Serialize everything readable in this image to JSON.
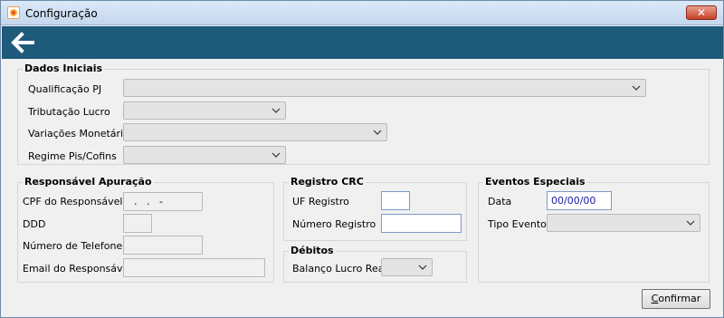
{
  "window": {
    "title": "Configuração",
    "close_label": "✕"
  },
  "toolbar": {
    "back_icon": "arrow-left-icon"
  },
  "dados_iniciais": {
    "title": "Dados Iniciais",
    "qualificacao_label": "Qualificação PJ",
    "qualificacao_value": "",
    "tributacao_label": "Tributação Lucro",
    "tributacao_value": "",
    "variacoes_label": "Variações Monetárias",
    "variacoes_value": "",
    "regime_label": "Regime Pis/Cofins",
    "regime_value": ""
  },
  "responsavel": {
    "title": "Responsável Apuração",
    "cpf_label": "CPF do Responsável",
    "cpf_value": "  .   .   -",
    "ddd_label": "DDD",
    "ddd_value": "",
    "telefone_label": "Número de Telefone",
    "telefone_value": "",
    "email_label": "Email do Responsável",
    "email_value": ""
  },
  "registro_crc": {
    "title": "Registro CRC",
    "uf_label": "UF Registro",
    "uf_value": "",
    "numero_label": "Número Registro",
    "numero_value": ""
  },
  "debitos": {
    "title": "Débitos",
    "balanco_label": "Balanço Lucro Real",
    "balanco_value": ""
  },
  "eventos": {
    "title": "Eventos Especiais",
    "data_label": "Data",
    "data_value": "00/00/00",
    "tipo_label": "Tipo Evento",
    "tipo_value": ""
  },
  "footer": {
    "confirm_first": "C",
    "confirm_rest": "onfirmar"
  }
}
